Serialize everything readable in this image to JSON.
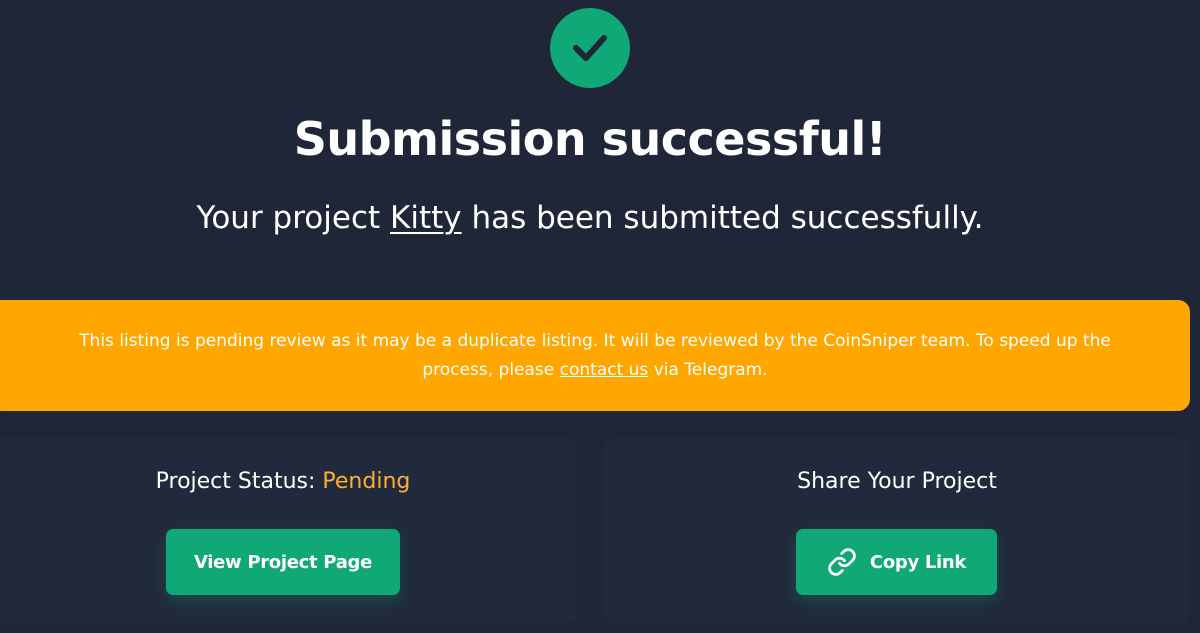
{
  "header": {
    "title": "Submission successful!",
    "subtitle_before": "Your project ",
    "project_name": "Kitty",
    "subtitle_after": " has been submitted successfully."
  },
  "alert": {
    "text_before": "This listing is pending review as it may be a duplicate listing. It will be reviewed by the CoinSniper team. To speed up the process, please ",
    "link_text": "contact us",
    "text_after": " via Telegram."
  },
  "status_card": {
    "label": "Project Status: ",
    "value": "Pending",
    "button_label": "View Project Page"
  },
  "share_card": {
    "title": "Share Your Project",
    "button_label": "Copy Link",
    "button_icon": "link-icon"
  },
  "icons": {
    "success": "check-icon"
  },
  "colors": {
    "background": "#1e2637",
    "card": "#212a3c",
    "accent_green": "#0fa876",
    "alert_orange": "#ffa700",
    "pending_orange": "#ffae2e"
  }
}
